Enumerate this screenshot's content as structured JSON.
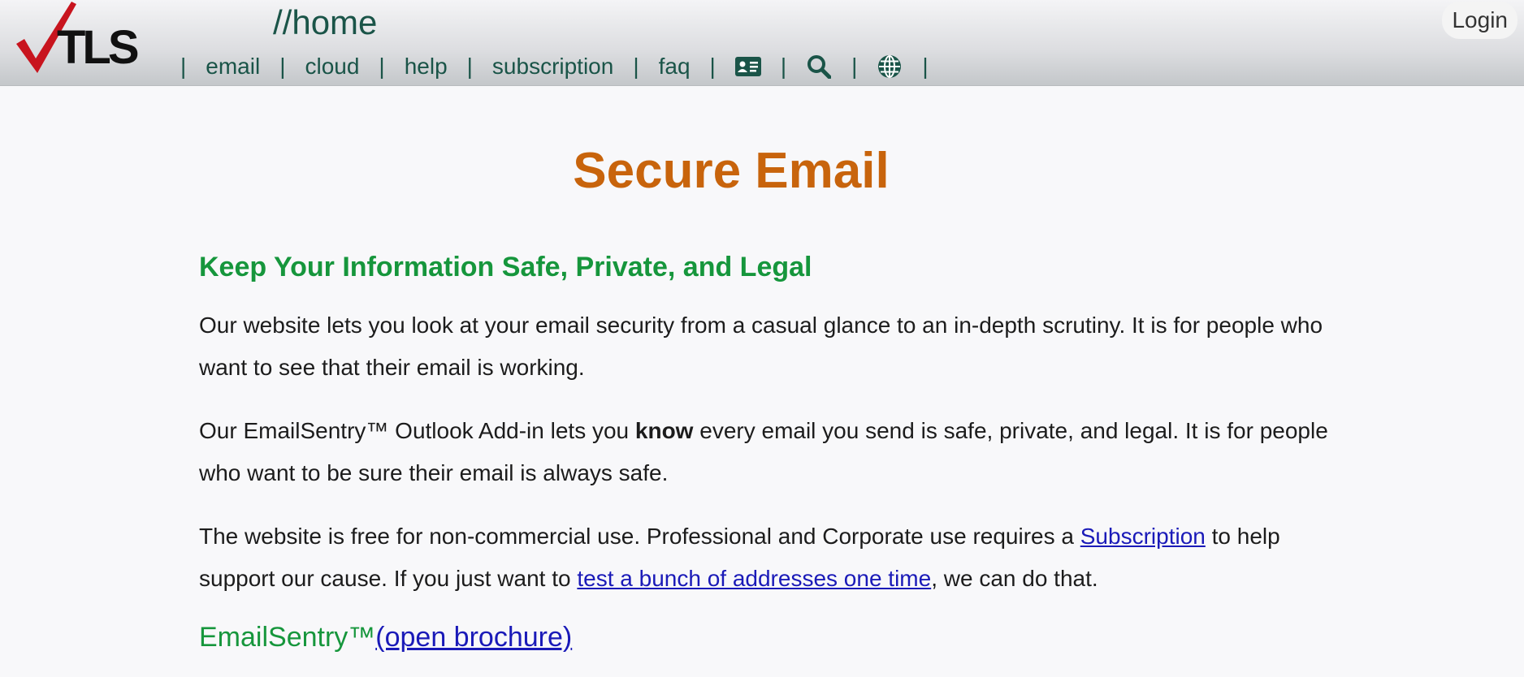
{
  "header": {
    "logo_text": "TLS",
    "breadcrumb": "//home",
    "nav": [
      {
        "label": "email"
      },
      {
        "label": "cloud"
      },
      {
        "label": "help"
      },
      {
        "label": "subscription"
      },
      {
        "label": "faq"
      }
    ],
    "nav_separator": "|",
    "nav_icons": [
      "contact-card-icon",
      "search-icon",
      "globe-icon"
    ],
    "login_label": "Login"
  },
  "colors": {
    "nav_text": "#1a5448",
    "title": "#c8640c",
    "subtitle": "#16963c",
    "link": "#1a1ab8",
    "logo_check": "#c8141e"
  },
  "main": {
    "title": "Secure Email",
    "subtitle": "Keep Your Information Safe, Private, and Legal",
    "para1": "Our website lets you look at your email security from a casual glance to an in-depth scrutiny. It is for people who want to see that their email is working.",
    "para2_before": "Our EmailSentry™ Outlook Add-in lets you ",
    "para2_bold": "know",
    "para2_after": " every email you send is safe, private, and legal. It is for people who want to be sure their email is always safe.",
    "para3_before": "The website is free for non-commercial use. Professional and Corporate use requires a ",
    "para3_link1": "Subscription",
    "para3_mid": " to help support our cause. If you just want to ",
    "para3_link2": "test a bunch of addresses one time",
    "para3_after": ", we can do that.",
    "es_heading": "EmailSentry™",
    "es_link": "(open brochure)"
  }
}
